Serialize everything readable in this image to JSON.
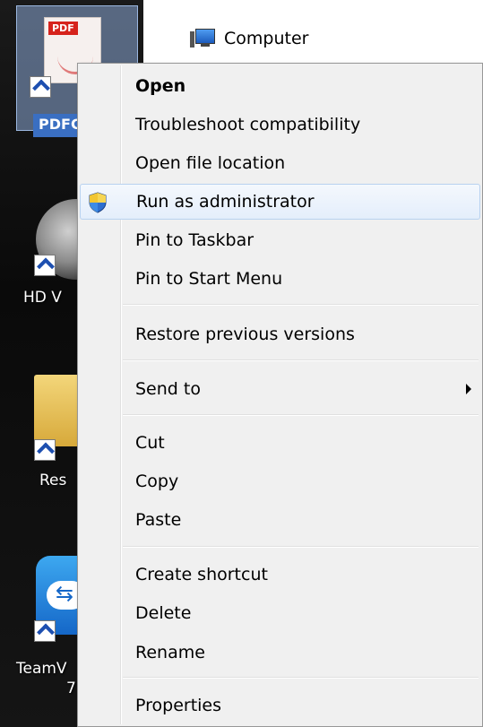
{
  "desktop": {
    "icons": [
      {
        "name": "pdf",
        "label": "PDFC"
      },
      {
        "name": "hd",
        "label": "HD V"
      },
      {
        "name": "folder",
        "label": "Res"
      },
      {
        "name": "teamviewer",
        "label": "TeamV",
        "sublabel": "7"
      }
    ],
    "pdf_badge": "PDF",
    "computer": {
      "label": "Computer"
    }
  },
  "context_menu": {
    "items": [
      {
        "label": "Open",
        "bold": true
      },
      {
        "label": "Troubleshoot compatibility"
      },
      {
        "label": "Open file location"
      },
      {
        "label": "Run as administrator",
        "icon": "shield-icon",
        "highlighted": true
      },
      {
        "label": "Pin to Taskbar"
      },
      {
        "label": "Pin to Start Menu"
      },
      {
        "label": "Restore previous versions"
      },
      {
        "label": "Send to",
        "submenu": true
      },
      {
        "label": "Cut"
      },
      {
        "label": "Copy"
      },
      {
        "label": "Paste"
      },
      {
        "label": "Create shortcut"
      },
      {
        "label": "Delete"
      },
      {
        "label": "Rename"
      },
      {
        "label": "Properties"
      }
    ]
  },
  "colors": {
    "menu_bg": "#f0f0f0",
    "hover_border": "#b8d2f0",
    "selection_blue": "#3a6fc2"
  }
}
